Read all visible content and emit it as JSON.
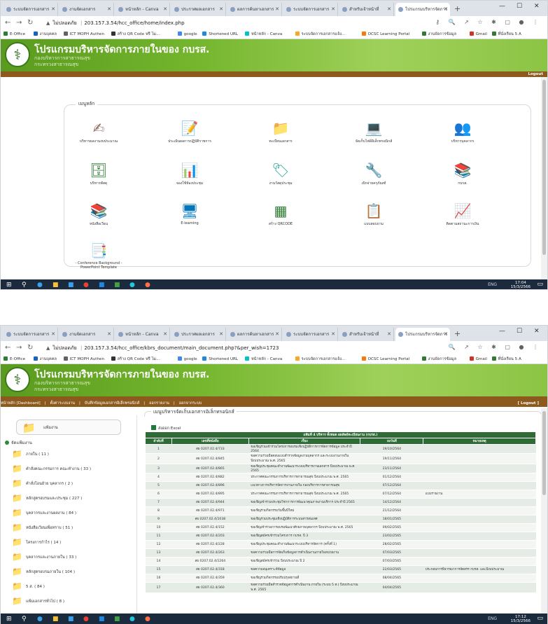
{
  "screen1": {
    "tabs": [
      {
        "label": "ระบบจัดการเอกสาร",
        "active": false
      },
      {
        "label": "งานจัดเอกสาร",
        "active": false
      },
      {
        "label": "หน้าหลัก - Canva",
        "active": false
      },
      {
        "label": "ประกาศผลเอกสาร",
        "active": false
      },
      {
        "label": "ผลการค้นหาเอกสาร",
        "active": false
      },
      {
        "label": "ระบบจัดการเอกสาร",
        "active": false
      },
      {
        "label": "สำหรับเจ้าหน้าที่",
        "active": false
      },
      {
        "label": "โปรแกรมบริหารจัดการ",
        "active": true
      }
    ],
    "url": "203.157.3.54/hcc_office/home/index.php",
    "lock_label": "ไม่ปลอดภัย",
    "bookmarks": [
      {
        "label": "E-Office",
        "color": "#2e7d32"
      },
      {
        "label": "งานบุคคล",
        "color": "#1565c0"
      },
      {
        "label": "ICT MOPH Authen",
        "color": "#5f6368"
      },
      {
        "label": "สร้าง QR Code ฟรี ไม...",
        "color": "#333333"
      },
      {
        "label": "google",
        "color": "#4285f4"
      },
      {
        "label": "Shortened URL",
        "color": "#1e88e5"
      },
      {
        "label": "หน้าหลัก - Canva",
        "color": "#00c4cc"
      },
      {
        "label": "ระบบจัดการเอกสารแจ้ง...",
        "color": "#f9a825"
      },
      {
        "label": "OCSC Learning Portal",
        "color": "#f57c00"
      },
      {
        "label": "งานจัดการข้อมูล",
        "color": "#2e7d32"
      },
      {
        "label": "Gmail",
        "color": "#d93025"
      },
      {
        "label": "ที่นั่งเรียน 5 A",
        "color": "#2e7d32"
      }
    ],
    "header": {
      "title": "โปรแกรมบริหารจัดการภายในของ กบรส.",
      "sub1": "กองบริหารการสาธารณสุข",
      "sub2": "กระทรวงสาธารณสุข"
    },
    "logout": "Logout",
    "panel_title": "เมนูหลัก",
    "icons": [
      {
        "label": "บริหารผลงานงบประมาณ",
        "glyph": "✍",
        "color": "#8d6e63"
      },
      {
        "label": "ประเมินผลการปฏิบัติราชการ",
        "glyph": "📝",
        "color": "#1565c0"
      },
      {
        "label": "ทะเบียนเอกสาร",
        "glyph": "📁",
        "color": "#f0a81c"
      },
      {
        "label": "จัดเก็บไฟล์อิเล็กทรอนิกส์",
        "glyph": "💻",
        "color": "#1e88e5"
      },
      {
        "label": "บริหารบุคลากร",
        "glyph": "👥",
        "color": "#6d4c41"
      },
      {
        "label": "บริหารพัสดุ",
        "glyph": "🗄",
        "color": "#2e7d32"
      },
      {
        "label": "จองใช้ห้องประชุม",
        "glyph": "📊",
        "color": "#3949ab"
      },
      {
        "label": "งานวัสดุประชุม",
        "glyph": "🏷",
        "color": "#26a69a"
      },
      {
        "label": "เบิกจ่ายครุภัณฑ์",
        "glyph": "🔧",
        "color": "#78909c"
      },
      {
        "label": "กบรส.",
        "glyph": "📚",
        "color": "#e53935"
      },
      {
        "label": "หนังสือเวียน",
        "glyph": "📚",
        "color": "#6d4c41"
      },
      {
        "label": "E-learning",
        "glyph": "🖥",
        "color": "#0277bd"
      },
      {
        "label": "สร้าง QRCODE",
        "glyph": "▦",
        "color": "#2e7d32"
      },
      {
        "label": "แบบสอบถาม",
        "glyph": "📋",
        "color": "#43a047"
      },
      {
        "label": "ติดตามสถานะการเงิน",
        "glyph": "📈",
        "color": "#f9a825"
      },
      {
        "label": "- Conference Background - PowerPoint Template",
        "glyph": "📑",
        "color": "#e57373"
      }
    ],
    "clock_time": "17:04",
    "clock_date": "15/3/2566",
    "tray": "ENG"
  },
  "screen2": {
    "tabs": [
      {
        "label": "ระบบจัดการเอกสาร",
        "active": false
      },
      {
        "label": "งานจัดเอกสาร",
        "active": false
      },
      {
        "label": "หน้าหลัก - Canva",
        "active": false
      },
      {
        "label": "ประกาศผลเอกสาร",
        "active": false
      },
      {
        "label": "ผลการค้นหาเอกสาร",
        "active": false
      },
      {
        "label": "ระบบจัดการเอกสาร",
        "active": false
      },
      {
        "label": "สำหรับเจ้าหน้าที่",
        "active": false
      },
      {
        "label": "โปรแกรมบริหารจัดการ",
        "active": true
      }
    ],
    "url": "203.157.3.54/hcc_office/kbrs_document/main_document.php?&per_wish=1723",
    "lock_label": "ไม่ปลอดภัย",
    "menu": [
      "หน้าหลัก [Dashboard]",
      "ตั้งค่าระบบงาน",
      "บันทึกข้อมูลเอกสารอิเล็กทรอนิกส์",
      "ออกรายงาน",
      "ออกจากระบบ"
    ],
    "logout": "[ Logout ]",
    "main_title": "เมนูบริหารจัดเก็บเอกสารอิเล็กทรอนิกส์",
    "sidebar_head": "แฟ้มงาน",
    "sidebar_category": "จัดแฟ้มงาน",
    "folders": [
      "ภายใน ( 11 )",
      "คำสั่งคณะกรรมการ คณะทำงาน ( 33 )",
      "คำสั่งโอนย้าย บุคลากร ( 2 )",
      "หลักสูตรอบรมและประชุม ( 227 )",
      "บุคลากรและงานผลงาน ( 84 )",
      "หนังสือเวียนเพื่อทราบ ( 51 )",
      "โครงการกำไร ( 14 )",
      "บุคลากรและงานภายใน ( 33 )",
      "หลักสูตรอบรมภายใน ( 104 )",
      "5 ส. ( 84 )",
      "แฟ้มเอกสารทั่วไป ( 8 )"
    ],
    "excel_label": "ส่งออก Excel",
    "table_caption": "แฟ้มที่ 4 บริหาร ทั้งหมด ผลลัพธ์ทะเบียนงาน (กบรส.)",
    "columns": [
      "ลำดับที่",
      "เลขที่หนังสือ",
      "เรื่อง",
      "ลงวันที่",
      "หมายเหตุ"
    ],
    "rows": [
      [
        "1",
        "สธ 0207.02.4/733",
        "ขอเชิญร่วมเข้าร่วมโครงการอบรมเชิงปฏิบัติการการจัดการข้อมูล ประจำปี 2564",
        "19/10/2564",
        ""
      ],
      [
        "2",
        "สธ 0207.02.4/845",
        "ขอความร่วมมือตอบแบบสำรวจข้อมูลงานบุคลากร และระบบงานภายใน ปีงบประมาณ พ.ศ. 2565",
        "19/11/2564",
        ""
      ],
      [
        "3",
        "สธ 0207.02.4/865",
        "ขอเชิญประชุมคณะทำงานพัฒนาระบบบริหารงานเอกสาร ปีงบประมาณ พ.ศ. 2565",
        "23/11/2564",
        ""
      ],
      [
        "4",
        "สธ 0207.02.4/882",
        "ประกาศคณะกรรมการบริหารการสาธารณสุข ปีงบประมาณ พ.ศ. 2565",
        "01/12/2564",
        ""
      ],
      [
        "5",
        "สธ 0207.02.4/896",
        "แนวทางการบริหารจัดการงานภายใน กองบริหารการสาธารณสุข",
        "07/12/2564",
        ""
      ],
      [
        "6",
        "สธ 0207.02.4/895",
        "ประกาศคณะกรรมการบริหารการสาธารณสุข ปีงบประมาณ พ.ศ. 2565",
        "07/12/2564",
        "แบบรายงาน"
      ],
      [
        "7",
        "สธ 0207.02.4/944",
        "ขอเชิญเข้าร่วมประชุมวิชาการการพัฒนาคุณภาพงานบริการ ประจำปี 2565",
        "14/12/2564",
        ""
      ],
      [
        "8",
        "สธ 0207.02.4/971",
        "ขอเชิญร่วมกิจกรรมวันขึ้นปีใหม่",
        "21/12/2564",
        ""
      ],
      [
        "9",
        "สธ 0207.02.4/1038",
        "ขอเชิญร่วมประชุมเชิงปฏิบัติการระบบสารสนเทศ",
        "18/01/2565",
        ""
      ],
      [
        "10",
        "สธ 0207.02.4/152",
        "ขอเชิญเข้าร่วมการอบรมพัฒนาศักยภาพบุคลากร ปีงบประมาณ พ.ศ. 2565",
        "09/02/2565",
        ""
      ],
      [
        "11",
        "สธ 0207.02.4/203",
        "ขอเชิญสมัครเข้าร่วมโครงการ กบรส. ปี 3",
        "23/02/2565",
        ""
      ],
      [
        "12",
        "สธ 0207.02.4/228",
        "ขอเชิญประชุมคณะทำงานพัฒนาระบบบริหารจัดการ (ครั้งที่ 1)",
        "28/02/2565",
        ""
      ],
      [
        "13",
        "สธ 0207.02.4/263",
        "ขอความร่วมมือการจัดเก็บข้อมูลการดำเนินงานภายในหน่วยงาน",
        "07/03/2565",
        ""
      ],
      [
        "14",
        "สธ 0207.02.4/1264",
        "ขอเชิญสมัครเข้าร่วม ปีงบประมาณ ปี 2",
        "07/03/2565",
        ""
      ],
      [
        "15",
        "สธ 0207.02.4/318",
        "ขอความอนุเคราะห์ข้อมูล",
        "22/03/2565",
        "ประกอบการพิจารณาการจัดสรร กบรส. และปีงบประมาณ"
      ],
      [
        "16",
        "สธ 0207.02.4/359",
        "ขอเชิญร่วมกิจกรรมปรับปรุงสถานที่",
        "08/04/2565",
        ""
      ],
      [
        "17",
        "สธ 0207.02.4/360",
        "ขอความร่วมมือสำรวจข้อมูลการดำเนินงาน ภายใน (ระบบ 5 ส.) ปีงบประมาณ พ.ศ. 2565",
        "04/04/2565",
        ""
      ]
    ],
    "clock_time": "17:12",
    "clock_date": "15/3/2566",
    "tray": "ENG"
  }
}
